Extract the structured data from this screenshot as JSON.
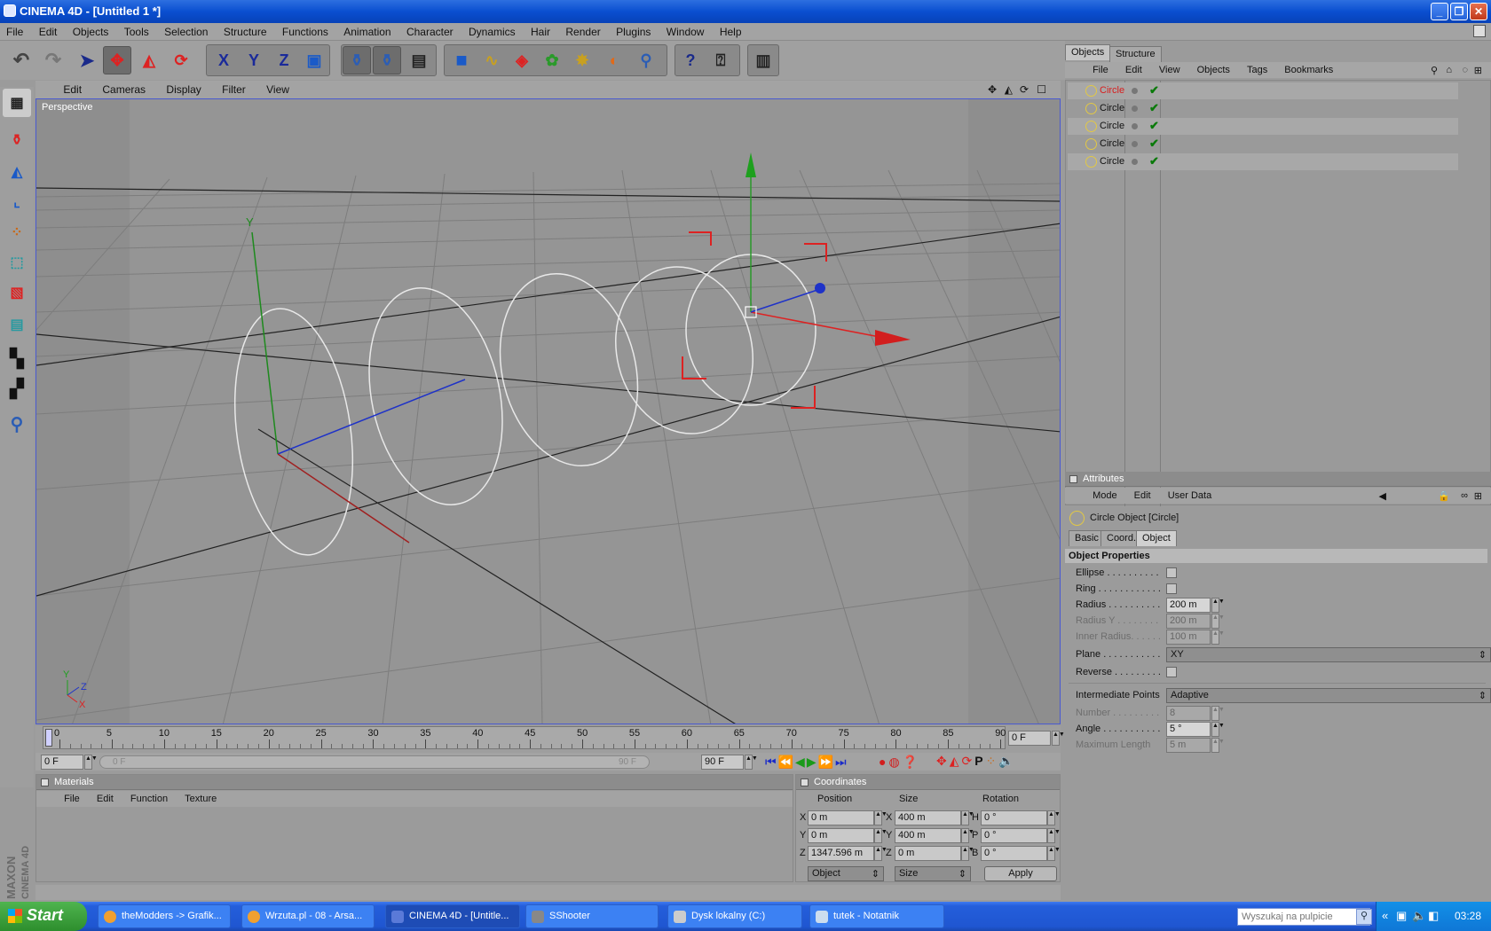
{
  "window": {
    "title": "CINEMA 4D - [Untitled 1 *]",
    "min": "_",
    "max": "❐",
    "close": "✕"
  },
  "menu": [
    "File",
    "Edit",
    "Objects",
    "Tools",
    "Selection",
    "Structure",
    "Functions",
    "Animation",
    "Character",
    "Dynamics",
    "Hair",
    "Render",
    "Plugins",
    "Window",
    "Help"
  ],
  "toolbar": {
    "x_axis": "X",
    "y_axis": "Y",
    "z_axis": "Z",
    "help": "?"
  },
  "viewport": {
    "menu": [
      "Edit",
      "Cameras",
      "Display",
      "Filter",
      "View"
    ],
    "label": "Perspective",
    "axis_y": "Y",
    "axis_small_y": "Y",
    "axis_small_z": "Z",
    "axis_small_x": "X"
  },
  "timeline": {
    "ticks": [
      "0",
      "5",
      "10",
      "15",
      "20",
      "25",
      "30",
      "35",
      "40",
      "45",
      "50",
      "55",
      "60",
      "65",
      "70",
      "75",
      "80",
      "85",
      "90"
    ],
    "current_frame": "0 F",
    "start_frame": "0 F",
    "slider_start": "0 F",
    "slider_end": "90 F",
    "end_frame": "90 F"
  },
  "materials": {
    "title": "Materials",
    "menu": [
      "File",
      "Edit",
      "Function",
      "Texture"
    ]
  },
  "coordinates": {
    "title": "Coordinates",
    "headers": {
      "position": "Position",
      "size": "Size",
      "rotation": "Rotation"
    },
    "rows": [
      {
        "axis": "X",
        "pos": "0 m",
        "size_axis": "X",
        "size": "400 m",
        "rot_axis": "H",
        "rot": "0 °"
      },
      {
        "axis": "Y",
        "pos": "0 m",
        "size_axis": "Y",
        "size": "400 m",
        "rot_axis": "P",
        "rot": "0 °"
      },
      {
        "axis": "Z",
        "pos": "1347.596 m",
        "size_axis": "Z",
        "size": "0 m",
        "rot_axis": "B",
        "rot": "0 °"
      }
    ],
    "mode": "Object",
    "size_mode": "Size",
    "apply": "Apply"
  },
  "objects": {
    "tabs": [
      "Objects",
      "Structure"
    ],
    "menu": [
      "File",
      "Edit",
      "View",
      "Objects",
      "Tags",
      "Bookmarks"
    ],
    "items": [
      {
        "name": "Circle",
        "selected": true
      },
      {
        "name": "Circle",
        "selected": false
      },
      {
        "name": "Circle",
        "selected": false
      },
      {
        "name": "Circle",
        "selected": false
      },
      {
        "name": "Circle",
        "selected": false
      }
    ]
  },
  "attributes": {
    "title": "Attributes",
    "menu": [
      "Mode",
      "Edit",
      "User Data"
    ],
    "object_title": "Circle Object [Circle]",
    "tabs": [
      "Basic",
      "Coord.",
      "Object"
    ],
    "section": "Object Properties",
    "props": {
      "ellipse": "Ellipse . . . . . . . . . .",
      "ring": "Ring . . . . . . . . . . . .",
      "radius": "Radius . . . . . . . . . .",
      "radius_val": "200 m",
      "radius_y": "Radius Y . . . . . . . .",
      "radius_y_val": "200 m",
      "inner_radius": "Inner Radius. . . . . .",
      "inner_radius_val": "100 m",
      "plane": "Plane . . . . . . . . . . .",
      "plane_val": "XY",
      "reverse": "Reverse . . . . . . . . .",
      "intermediate": "Intermediate Points",
      "intermediate_val": "Adaptive",
      "number": "Number . . . . . . . . .",
      "number_val": "8",
      "angle": "Angle . . . . . . . . . . .",
      "angle_val": "5 °",
      "max_length": "Maximum Length",
      "max_length_val": "5 m"
    }
  },
  "taskbar": {
    "start": "Start",
    "tasks": [
      "theModders -> Grafik...",
      "Wrzuta.pl - 08 - Arsa...",
      "CINEMA 4D - [Untitle...",
      "SShooter",
      "Dysk lokalny (C:)",
      "tutek - Notatnik"
    ],
    "search_placeholder": "Wyszukaj na pulpicie",
    "clock": "03:28"
  },
  "branding": {
    "maxon": "MAXON",
    "cinema": "CINEMA 4D"
  },
  "colors": {
    "accent": "#0a4fd0",
    "selected_object": "#d81e1e",
    "axis_x": "#c81e1e",
    "axis_y": "#1ea01e",
    "axis_z": "#1e32c8"
  }
}
